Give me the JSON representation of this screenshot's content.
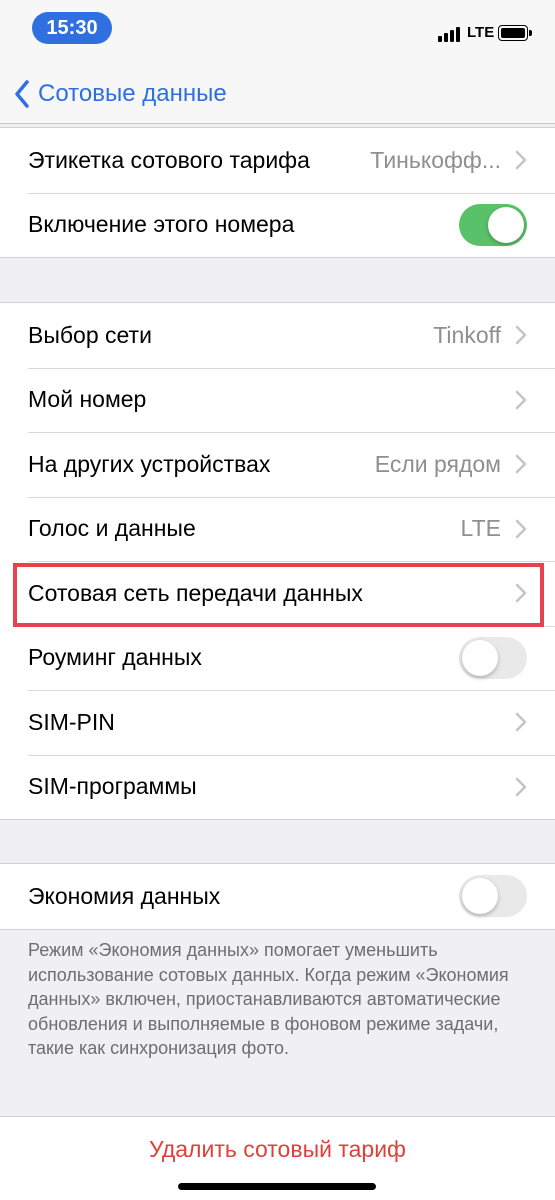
{
  "status_bar": {
    "time": "15:30",
    "network": "LTE",
    "icons": [
      "signal-icon",
      "battery-icon"
    ]
  },
  "nav": {
    "back_label": "Сотовые данные",
    "back_icon": "chevron-left-icon"
  },
  "colors": {
    "accent": "#2f6fe0",
    "toggle_on": "#5ac16b",
    "destructive": "#e0403a",
    "highlight": "#e8414f"
  },
  "group1": {
    "plan_label": {
      "label": "Этикетка сотового тарифа",
      "value": "Тинькофф..."
    },
    "line_enabled": {
      "label": "Включение этого номера",
      "on": true
    }
  },
  "group2": {
    "network_selection": {
      "label": "Выбор сети",
      "value": "Tinkoff"
    },
    "my_number": {
      "label": "Мой номер"
    },
    "other_devices": {
      "label": "На других устройствах",
      "value": "Если рядом"
    },
    "voice_data": {
      "label": "Голос и данные",
      "value": "LTE"
    },
    "cellular_data_network": {
      "label": "Сотовая сеть передачи данных"
    },
    "data_roaming": {
      "label": "Роуминг данных",
      "on": false
    },
    "sim_pin": {
      "label": "SIM-PIN"
    },
    "sim_apps": {
      "label": "SIM-программы"
    }
  },
  "group3": {
    "low_data_mode": {
      "label": "Экономия данных",
      "on": false
    },
    "note": "Режим «Экономия данных» помогает уменьшить использование сотовых данных. Когда режим «Экономия данных» включен, приостанавливаются автоматические обновления и выполняемые в фоновом режиме задачи, такие как синхронизация фото."
  },
  "group4": {
    "delete_plan": "Удалить сотовый тариф"
  }
}
